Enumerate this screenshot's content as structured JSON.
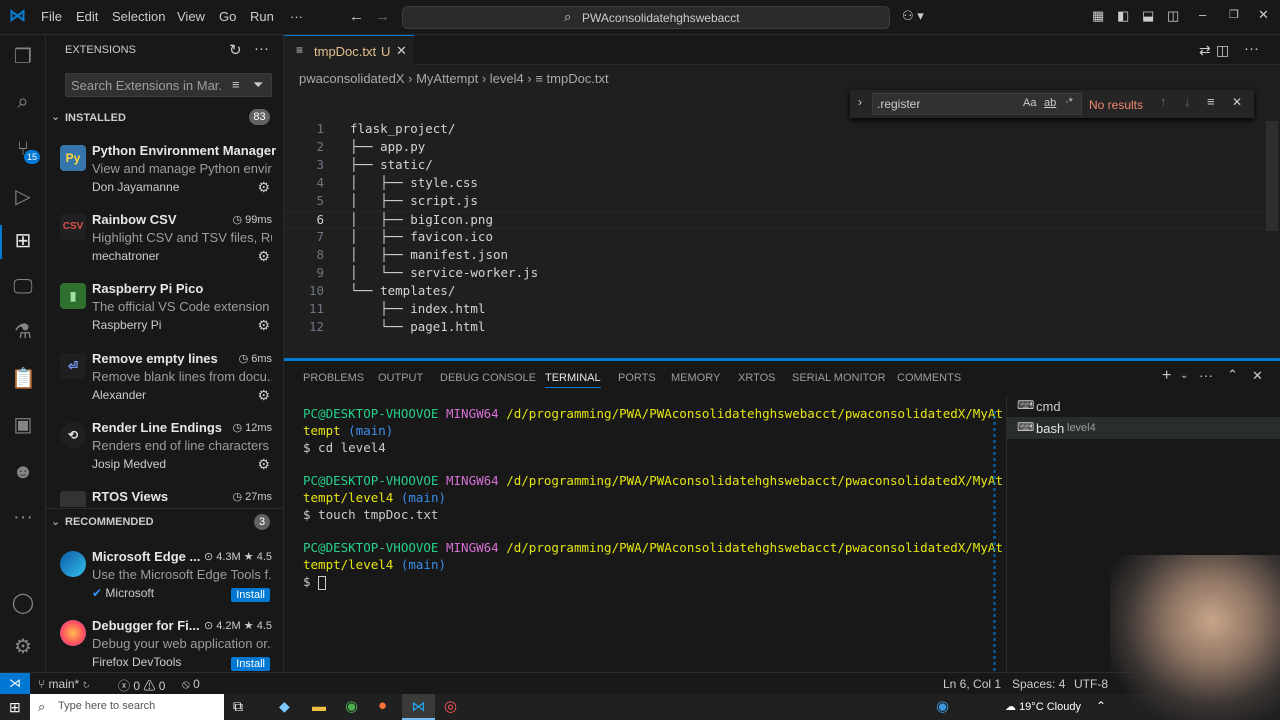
{
  "menu": [
    "File",
    "Edit",
    "Selection",
    "View",
    "Go",
    "Run",
    "···"
  ],
  "command_center": {
    "label": "PWAconsolidatehghswebacct"
  },
  "sidebar": {
    "title": "EXTENSIONS",
    "search_placeholder": "Search Extensions in Mar...",
    "installed_label": "INSTALLED",
    "installed_count": "83",
    "recommended_label": "RECOMMENDED",
    "recommended_count": "3",
    "installed": [
      {
        "name": "Python Environment Manager",
        "desc": "View and manage Python envir...",
        "pub": "Don Jayamanne",
        "meta": "",
        "logo": "Py",
        "logo_color": "#3776ab"
      },
      {
        "name": "Rainbow CSV",
        "desc": "Highlight CSV and TSV files, Ru...",
        "pub": "mechatroner",
        "meta": "99ms",
        "logo": "CSV",
        "logo_color": "#d23c3c"
      },
      {
        "name": "Raspberry Pi Pico",
        "desc": "The official VS Code extension ...",
        "pub": "Raspberry Pi",
        "meta": "",
        "logo": "▮",
        "logo_color": "#3c9e3c"
      },
      {
        "name": "Remove empty lines",
        "desc": "Remove blank lines from docu...",
        "pub": "Alexander",
        "meta": "6ms",
        "logo": "⏎",
        "logo_color": "#5a6fd6"
      },
      {
        "name": "Render Line Endings",
        "desc": "Renders end of line characters ...",
        "pub": "Josip Medved",
        "meta": "12ms",
        "logo": "⟲",
        "logo_color": "#e0e0e0"
      },
      {
        "name": "RTOS Views",
        "desc": "",
        "pub": "",
        "meta": "27ms",
        "logo": "",
        "logo_color": "#444"
      }
    ],
    "recommended": [
      {
        "name": "Microsoft Edge ...",
        "desc": "Use the Microsoft Edge Tools f...",
        "pub": "Microsoft",
        "downloads": "4.3M",
        "rating": "4.5",
        "install": "Install"
      },
      {
        "name": "Debugger for Fi...",
        "desc": "Debug your web application or...",
        "pub": "Firefox DevTools",
        "downloads": "4.2M",
        "rating": "4.5",
        "install": "Install"
      }
    ]
  },
  "editor": {
    "tab_name": "tmpDoc.txt",
    "tab_status": "U",
    "breadcrumb": [
      "pwaconsolidatedX",
      "MyAttempt",
      "level4",
      "tmpDoc.txt"
    ],
    "find": {
      "query": ".register",
      "result": "No results",
      "options": [
        "Aa",
        "ab",
        "·*"
      ]
    },
    "lines": [
      "flask_project/",
      "├── app.py",
      "├── static/",
      "│   ├── style.css",
      "│   ├── script.js",
      "│   ├── bigIcon.png",
      "│   ├── favicon.ico",
      "│   ├── manifest.json",
      "│   └── service-worker.js",
      "└── templates/",
      "    ├── index.html",
      "    └── page1.html"
    ],
    "line_numbers": [
      "1",
      "2",
      "3",
      "4",
      "5",
      "6",
      "7",
      "8",
      "9",
      "10",
      "11",
      "12"
    ]
  },
  "panel": {
    "tabs": [
      "PROBLEMS",
      "OUTPUT",
      "DEBUG CONSOLE",
      "TERMINAL",
      "PORTS",
      "MEMORY",
      "XRTOS",
      "SERIAL MONITOR",
      "COMMENTS"
    ],
    "active_tab": "TERMINAL",
    "terminals": [
      {
        "name": "cmd",
        "sub": ""
      },
      {
        "name": "bash",
        "sub": "level4"
      }
    ],
    "term": {
      "user": "PC@DESKTOP-VHOOVOE",
      "shell": "MINGW64",
      "path1a": "/d/programming/PWA/PWAconsolidatehghswebacct/pwaconsolidatedX/MyAt",
      "path1b": "tempt",
      "path2b": "tempt/level4",
      "branch": "(main)",
      "cmd1": "$ cd level4",
      "cmd2": "$ touch tmpDoc.txt",
      "prompt": "$ "
    }
  },
  "status": {
    "branch": "main*",
    "errors": "0",
    "warnings": "0",
    "ports": "0",
    "position": "Ln 6, Col 1",
    "spaces": "Spaces: 4",
    "encoding": "UTF-8"
  },
  "taskbar": {
    "search_placeholder": "Type here to search",
    "weather": "19°C  Cloudy"
  },
  "colors": {
    "accent": "#0078d4",
    "term_green": "#23d18b",
    "term_magenta": "#d670d6",
    "term_yellow": "#e5e510",
    "term_blue": "#3b8eea"
  }
}
